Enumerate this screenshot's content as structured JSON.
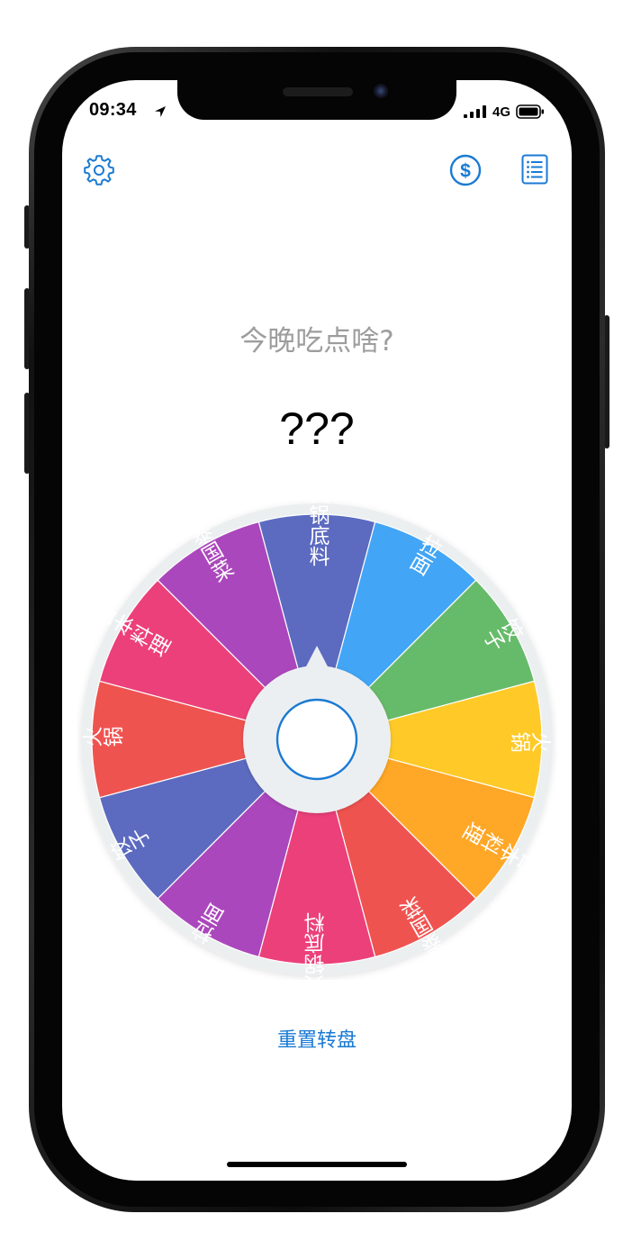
{
  "status_bar": {
    "time": "09:34",
    "network": "4G"
  },
  "toolbar": {
    "settings_icon": "gear-icon",
    "donate_icon": "dollar-circle-icon",
    "list_icon": "list-icon",
    "accent_color": "#1a7ad4"
  },
  "prompt": {
    "question": "今晚吃点啥?",
    "result": "???"
  },
  "wheel": {
    "segments": [
      {
        "label": "火锅底料",
        "color": "#5c6bc0"
      },
      {
        "label": "拉面",
        "color": "#42a5f5"
      },
      {
        "label": "饺子",
        "color": "#66bb6a"
      },
      {
        "label": "火锅",
        "color": "#ffca28"
      },
      {
        "label": "日本料理",
        "color": "#ffa726"
      },
      {
        "label": "泰国菜",
        "color": "#ef5350"
      },
      {
        "label": "火锅底料",
        "color": "#ec407a"
      },
      {
        "label": "拉面",
        "color": "#ab47bc"
      },
      {
        "label": "饺子",
        "color": "#5c6bc0"
      },
      {
        "label": "火锅",
        "color": "#ef5350"
      },
      {
        "label": "日本料理",
        "color": "#ec407a"
      },
      {
        "label": "泰国菜",
        "color": "#ab47bc"
      }
    ],
    "spin_button_ring_color": "#1a7ad4"
  },
  "actions": {
    "reset_label": "重置转盘"
  }
}
